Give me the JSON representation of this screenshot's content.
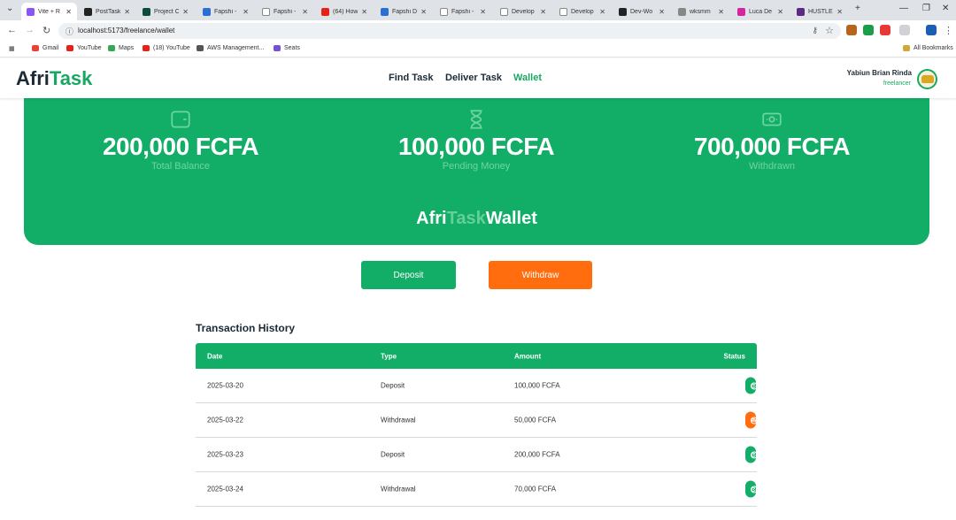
{
  "browser": {
    "tabs": [
      {
        "title": "Vite + R",
        "color": "#8a55f7",
        "active": true
      },
      {
        "title": "PostTask",
        "color": "#222222"
      },
      {
        "title": "Project C",
        "color": "#0d4b3a"
      },
      {
        "title": "Fapshi - ",
        "color": "#2a6fd6"
      },
      {
        "title": "Fapshi - ",
        "color": "#ffffff"
      },
      {
        "title": "(64) How",
        "color": "#e62117"
      },
      {
        "title": "Fapshi D",
        "color": "#2a6fd6"
      },
      {
        "title": "Fapshi - ",
        "color": "#ffffff"
      },
      {
        "title": "Develop",
        "color": "#ffffff"
      },
      {
        "title": "Develop",
        "color": "#ffffff"
      },
      {
        "title": "Dev-Wo",
        "color": "#222222"
      },
      {
        "title": "wksmm",
        "color": "#888888"
      },
      {
        "title": "Luca De",
        "color": "#d6249f"
      },
      {
        "title": "HUSTLE",
        "color": "#5b2a86"
      }
    ],
    "new_tab": "+",
    "url": "localhost:5173/freelance/wallet",
    "bookmarks": [
      {
        "label": "Gmail",
        "color": "#ea4335"
      },
      {
        "label": "YouTube",
        "color": "#e62117"
      },
      {
        "label": "Maps",
        "color": "#34a853"
      },
      {
        "label": "(18) YouTube",
        "color": "#e62117"
      },
      {
        "label": "AWS Management...",
        "color": "#555555"
      },
      {
        "label": "Seats",
        "color": "#7a4fd6"
      }
    ],
    "all_bookmarks": "All Bookmarks"
  },
  "header": {
    "logo_part1": "Afri",
    "logo_part2": "Task",
    "nav": [
      "Find Task",
      "Deliver Task",
      "Wallet"
    ],
    "active_nav": "Wallet",
    "user_name": "Yabiun Brian Rinda",
    "user_role": "freelancer"
  },
  "wallet": {
    "stats": [
      {
        "icon": "wallet-icon",
        "amount": "200,000 FCFA",
        "label": "Total Balance"
      },
      {
        "icon": "hourglass-icon",
        "amount": "100,000 FCFA",
        "label": "Pending Money"
      },
      {
        "icon": "banknote-icon",
        "amount": "700,000 FCFA",
        "label": "Withdrawn"
      }
    ],
    "brand_part1": "Afri",
    "brand_part2": "Task",
    "brand_part3": "Wallet"
  },
  "actions": {
    "deposit": "Deposit",
    "withdraw": "Withdraw"
  },
  "transactions": {
    "title": "Transaction History",
    "columns": [
      "Date",
      "Type",
      "Amount",
      "Status"
    ],
    "rows": [
      {
        "date": "2025-03-20",
        "type": "Deposit",
        "amount": "100,000 FCFA",
        "status": "Completed"
      },
      {
        "date": "2025-03-22",
        "type": "Withdrawal",
        "amount": "50,000 FCFA",
        "status": "Pending"
      },
      {
        "date": "2025-03-23",
        "type": "Deposit",
        "amount": "200,000 FCFA",
        "status": "Completed"
      },
      {
        "date": "2025-03-24",
        "type": "Withdrawal",
        "amount": "70,000 FCFA",
        "status": "Completed"
      }
    ]
  },
  "colors": {
    "brand_green": "#12ae67",
    "accent_orange": "#ff6d0e",
    "text_dark": "#1b2a36"
  }
}
